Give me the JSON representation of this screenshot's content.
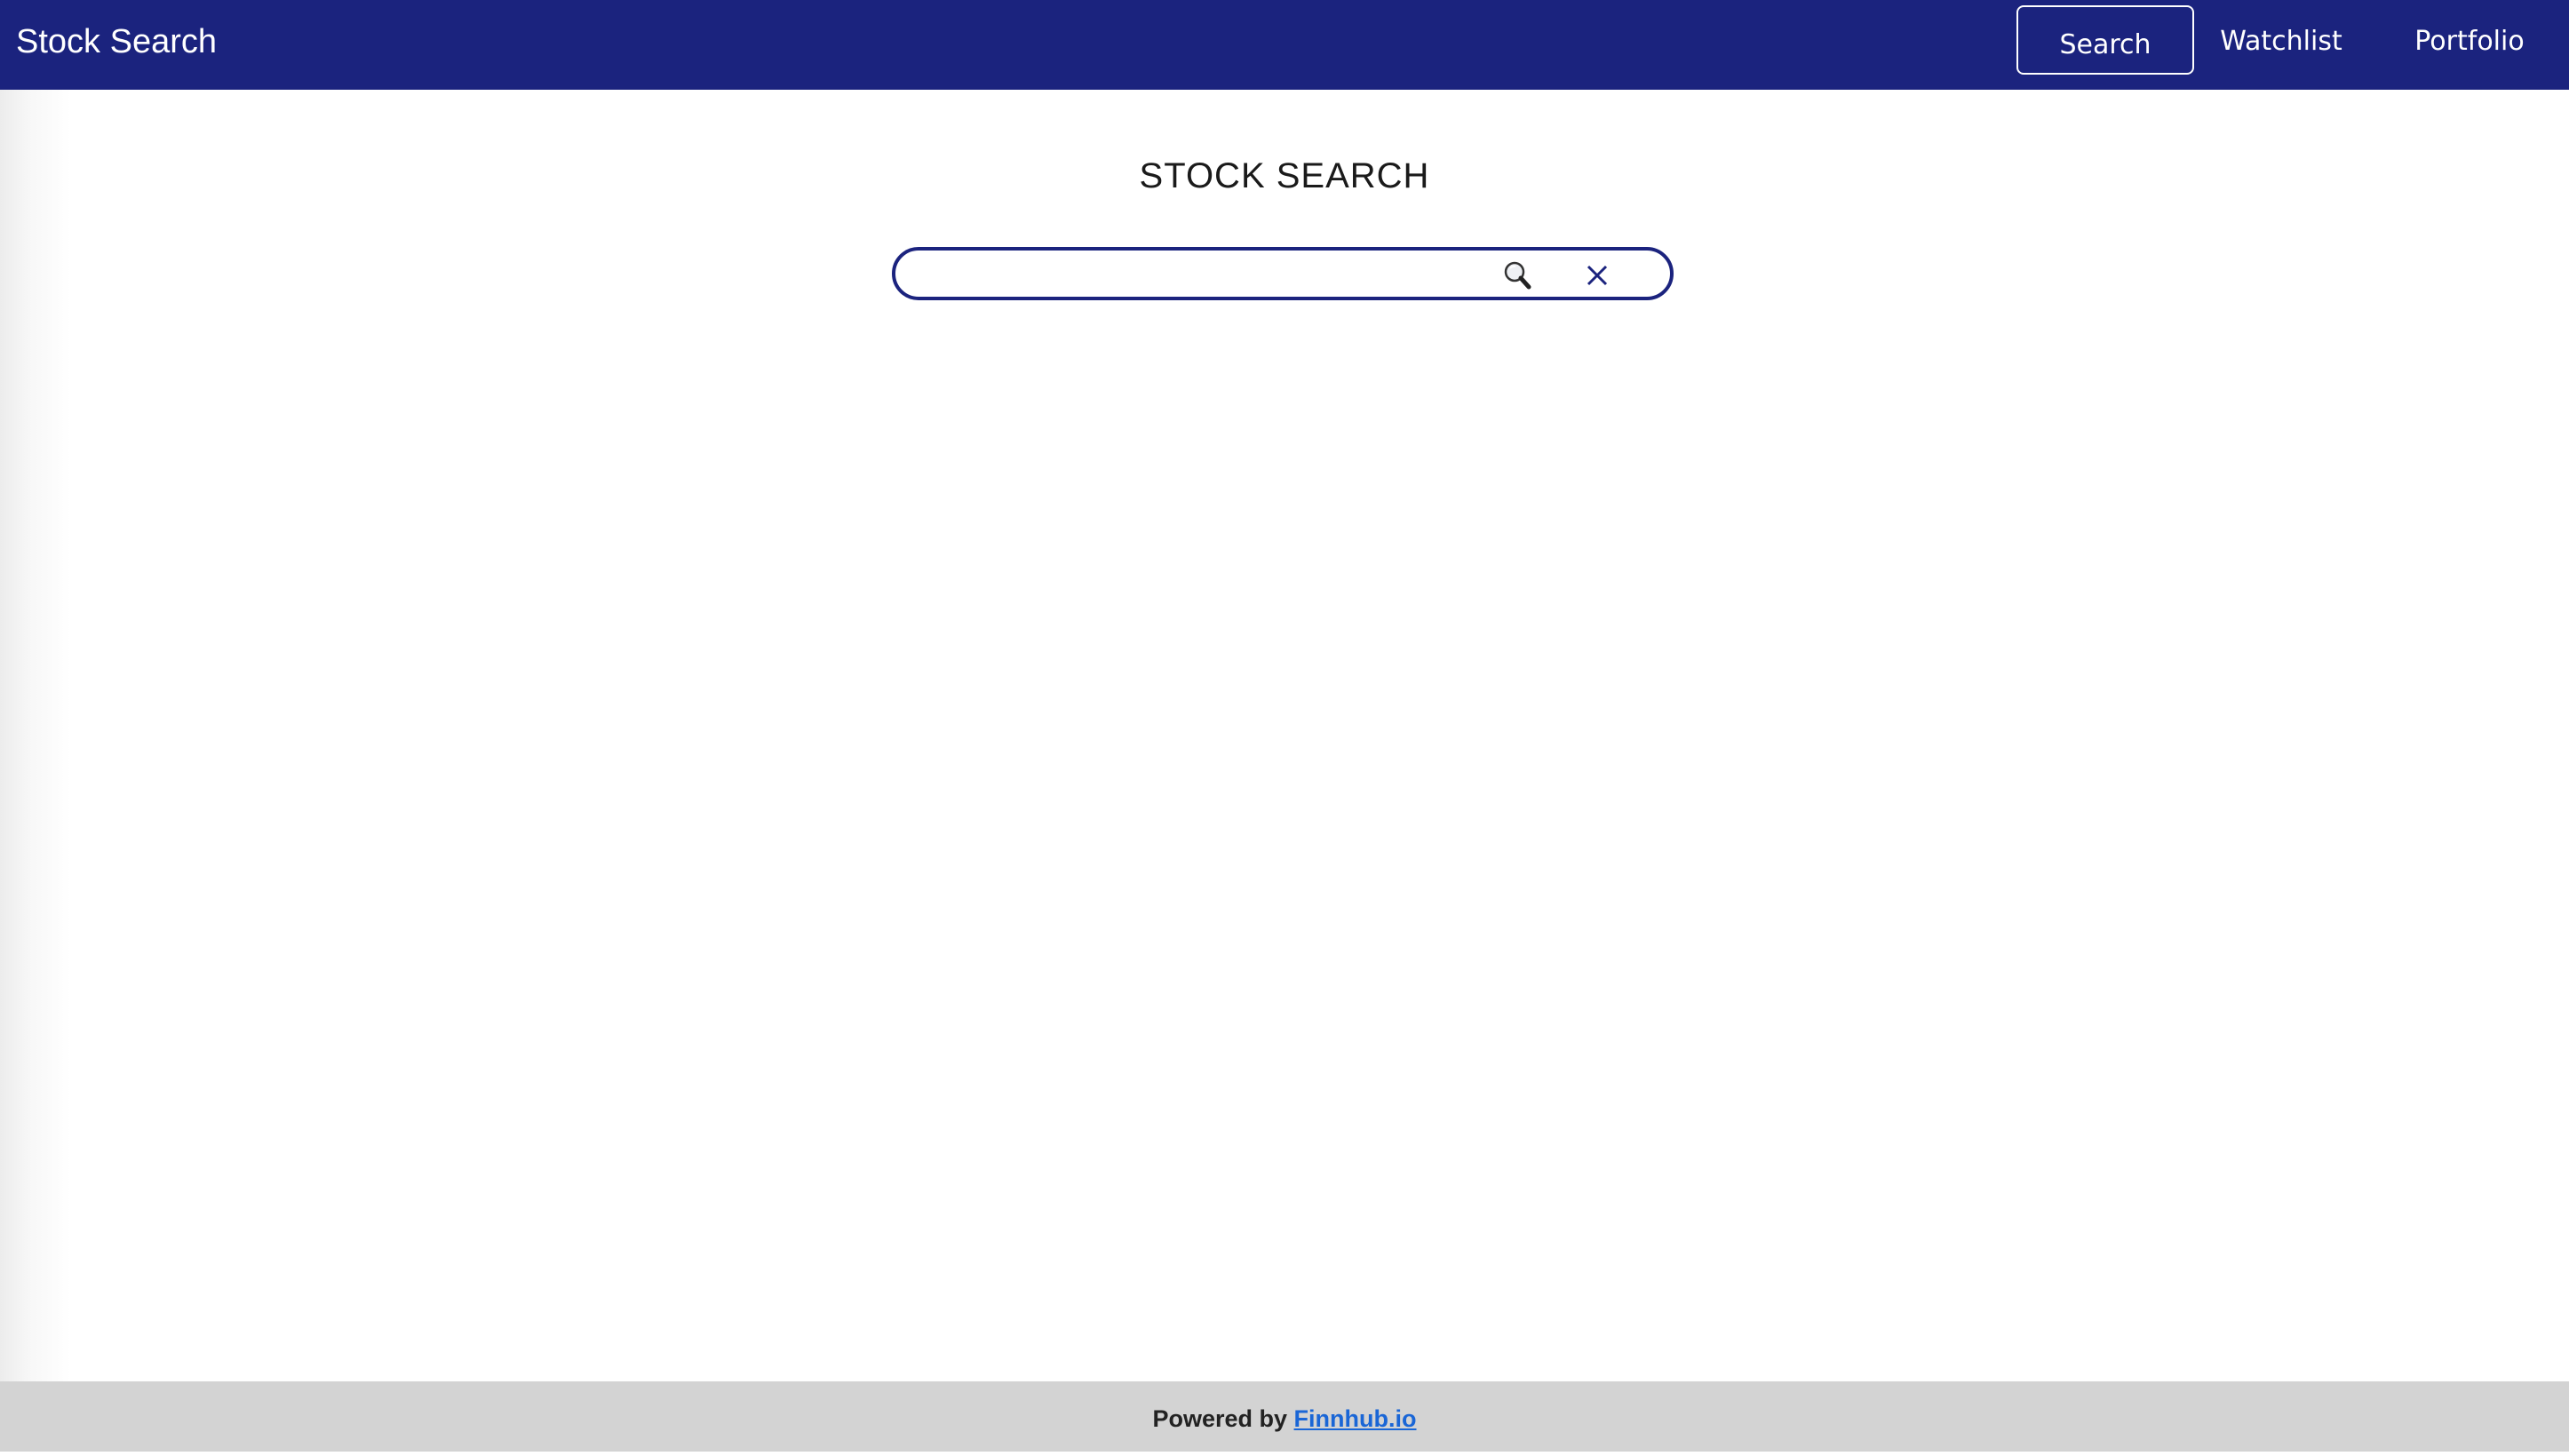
{
  "navbar": {
    "brand": "Stock Search",
    "links": [
      {
        "label": "Search",
        "active": true
      },
      {
        "label": "Watchlist",
        "active": false
      },
      {
        "label": "Portfolio",
        "active": false
      }
    ],
    "background_color": "#1b237e"
  },
  "main": {
    "title": "STOCK SEARCH",
    "search": {
      "value": "",
      "placeholder": "",
      "search_icon": "magnifier-icon",
      "clear_icon": "close-icon"
    }
  },
  "footer": {
    "prefix": "Powered by ",
    "link_text": "Finnhub.io",
    "background_color": "#d3d3d3"
  }
}
